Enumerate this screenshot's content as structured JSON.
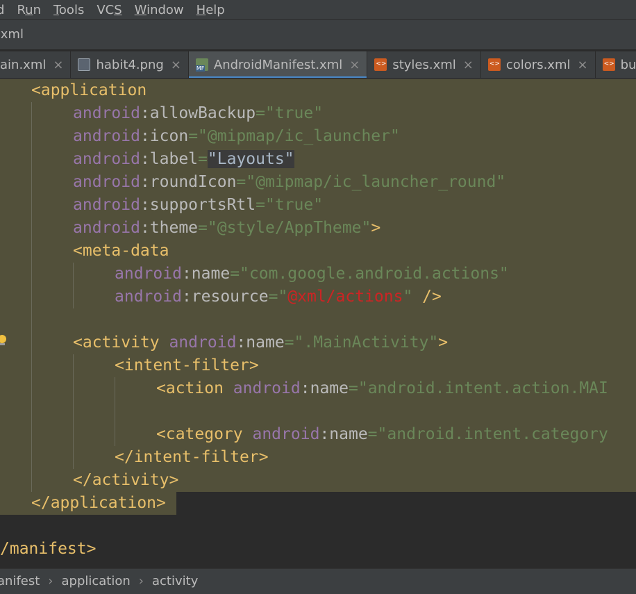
{
  "menu": {
    "items": [
      {
        "pre": "",
        "u": "",
        "post": "d"
      },
      {
        "pre": "R",
        "u": "u",
        "post": "n"
      },
      {
        "pre": "",
        "u": "T",
        "post": "ools"
      },
      {
        "pre": "VC",
        "u": "S",
        "post": ""
      },
      {
        "pre": "",
        "u": "W",
        "post": "indow"
      },
      {
        "pre": "",
        "u": "H",
        "post": "elp"
      }
    ]
  },
  "path": {
    "file": "t.xml"
  },
  "tabs": [
    {
      "label": "ain.xml",
      "icon": "xml-file-icon",
      "active": false
    },
    {
      "label": "habit4.png",
      "icon": "image-file-icon",
      "active": false
    },
    {
      "label": "AndroidManifest.xml",
      "icon": "manifest-file-icon",
      "active": true
    },
    {
      "label": "styles.xml",
      "icon": "xml-file-icon",
      "active": false
    },
    {
      "label": "colors.xml",
      "icon": "xml-file-icon",
      "active": false
    },
    {
      "label": "butto",
      "icon": "xml-file-icon",
      "active": false
    }
  ],
  "tab_close": "×",
  "code": {
    "l1": {
      "tag": "<application"
    },
    "l2": {
      "ns": "android",
      "colon": ":",
      "attr": "allowBackup",
      "eq": "=",
      "val": "\"true\""
    },
    "l3": {
      "ns": "android",
      "colon": ":",
      "attr": "icon",
      "eq": "=",
      "val": "\"@mipmap/ic_launcher\""
    },
    "l4": {
      "ns": "android",
      "colon": ":",
      "attr": "label",
      "eq": "=",
      "val": "\"Layouts\""
    },
    "l5": {
      "ns": "android",
      "colon": ":",
      "attr": "roundIcon",
      "eq": "=",
      "val": "\"@mipmap/ic_launcher_round\""
    },
    "l6": {
      "ns": "android",
      "colon": ":",
      "attr": "supportsRtl",
      "eq": "=",
      "val": "\"true\""
    },
    "l7": {
      "ns": "android",
      "colon": ":",
      "attr": "theme",
      "eq": "=",
      "val": "\"@style/AppTheme\"",
      "end": ">"
    },
    "l8": {
      "tag": "<meta-data"
    },
    "l9": {
      "ns": "android",
      "colon": ":",
      "attr": "name",
      "eq": "=",
      "val": "\"com.google.android.actions\""
    },
    "l10": {
      "ns": "android",
      "colon": ":",
      "attr": "resource",
      "eq": "=",
      "q1": "\"",
      "valred": "@xml/actions",
      "q2": "\"",
      "end": " />"
    },
    "l12": {
      "tag": "<activity",
      "sp": " ",
      "ns": "android",
      "colon": ":",
      "attr": "name",
      "eq": "=",
      "val": "\".MainActivity\"",
      "end": ">"
    },
    "l13": {
      "tag": "<intent-filter>"
    },
    "l14": {
      "tag": "<action",
      "sp": " ",
      "ns": "android",
      "colon": ":",
      "attr": "name",
      "eq": "=",
      "val": "\"android.intent.action.MAI"
    },
    "l16": {
      "tag": "<category",
      "sp": " ",
      "ns": "android",
      "colon": ":",
      "attr": "name",
      "eq": "=",
      "val": "\"android.intent.category"
    },
    "l17": {
      "tag": "</intent-filter>"
    },
    "l18": {
      "tag": "</activity>"
    },
    "l19": {
      "tag": "</application>"
    },
    "l21": {
      "tag": "/manifest>"
    }
  },
  "breadcrumb": {
    "items": [
      "anifest",
      "application",
      "activity"
    ],
    "sep": "›"
  },
  "colors": {
    "tag": "#e8bf6a",
    "namespace": "#9876aa",
    "string": "#6a8759",
    "error_string": "#cc2424",
    "highlight": "#52503a",
    "active_tab_underline": "#4a88c7"
  }
}
